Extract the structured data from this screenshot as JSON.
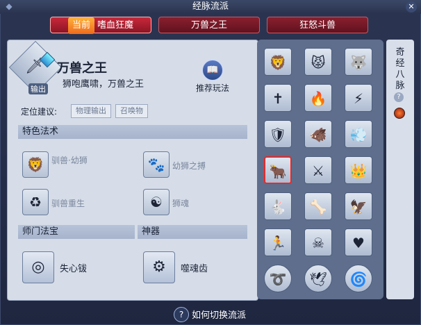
{
  "window": {
    "title": "经脉流派"
  },
  "tabs": [
    {
      "badge": "当前",
      "label": "嗜血狂魔",
      "active": true
    },
    {
      "label": "万兽之王",
      "active": false
    },
    {
      "label": "狂怒斗兽",
      "active": false
    }
  ],
  "school": {
    "name": "万兽之王",
    "description": "狮咆鹰啸，万兽之王",
    "role_tag": "输出",
    "recommend_label": "推荐玩法"
  },
  "positioning": {
    "label": "定位建议:",
    "chips": [
      "物理输出",
      "召唤物"
    ]
  },
  "sections": {
    "special_spells": "特色法术",
    "sect_treasure": "师门法宝",
    "artifact": "神器"
  },
  "spells": [
    {
      "name": "驯兽·幼狮",
      "icon": "lion-cub-icon"
    },
    {
      "name": "幼狮之搏",
      "icon": "lion-roar-icon"
    },
    {
      "name": "驯兽重生",
      "icon": "rebirth-icon"
    },
    {
      "name": "狮魂",
      "icon": "lion-soul-icon"
    }
  ],
  "treasure": {
    "name": "失心钹",
    "icon": "cymbal-icon"
  },
  "artifact": {
    "name": "噬魂齿",
    "icon": "soul-teeth-icon"
  },
  "meridian_grid": {
    "rows": 6,
    "cols": 3,
    "selected_index": 9,
    "cells": [
      "lion-head-icon",
      "lion-face-icon",
      "beast-roar-icon",
      "cross-lion-icon",
      "fire-lion-icon",
      "claw-icon",
      "armor-icon",
      "shadow-beast-icon",
      "charge-icon",
      "ox-icon",
      "sword-rain-icon",
      "lion-crown-icon",
      "rabbit-claw-icon",
      "bone-icon",
      "eagle-icon",
      "runner-icon",
      "skull-plus-icon",
      "heart-cross-icon",
      "spiral-icon",
      "wing-icon",
      "swirl-icon"
    ]
  },
  "side": {
    "label": "奇经八脉",
    "help_icon": "question-icon",
    "element_icon": "fire-orb-icon"
  },
  "footer": {
    "help_text": "如何切换流派"
  }
}
